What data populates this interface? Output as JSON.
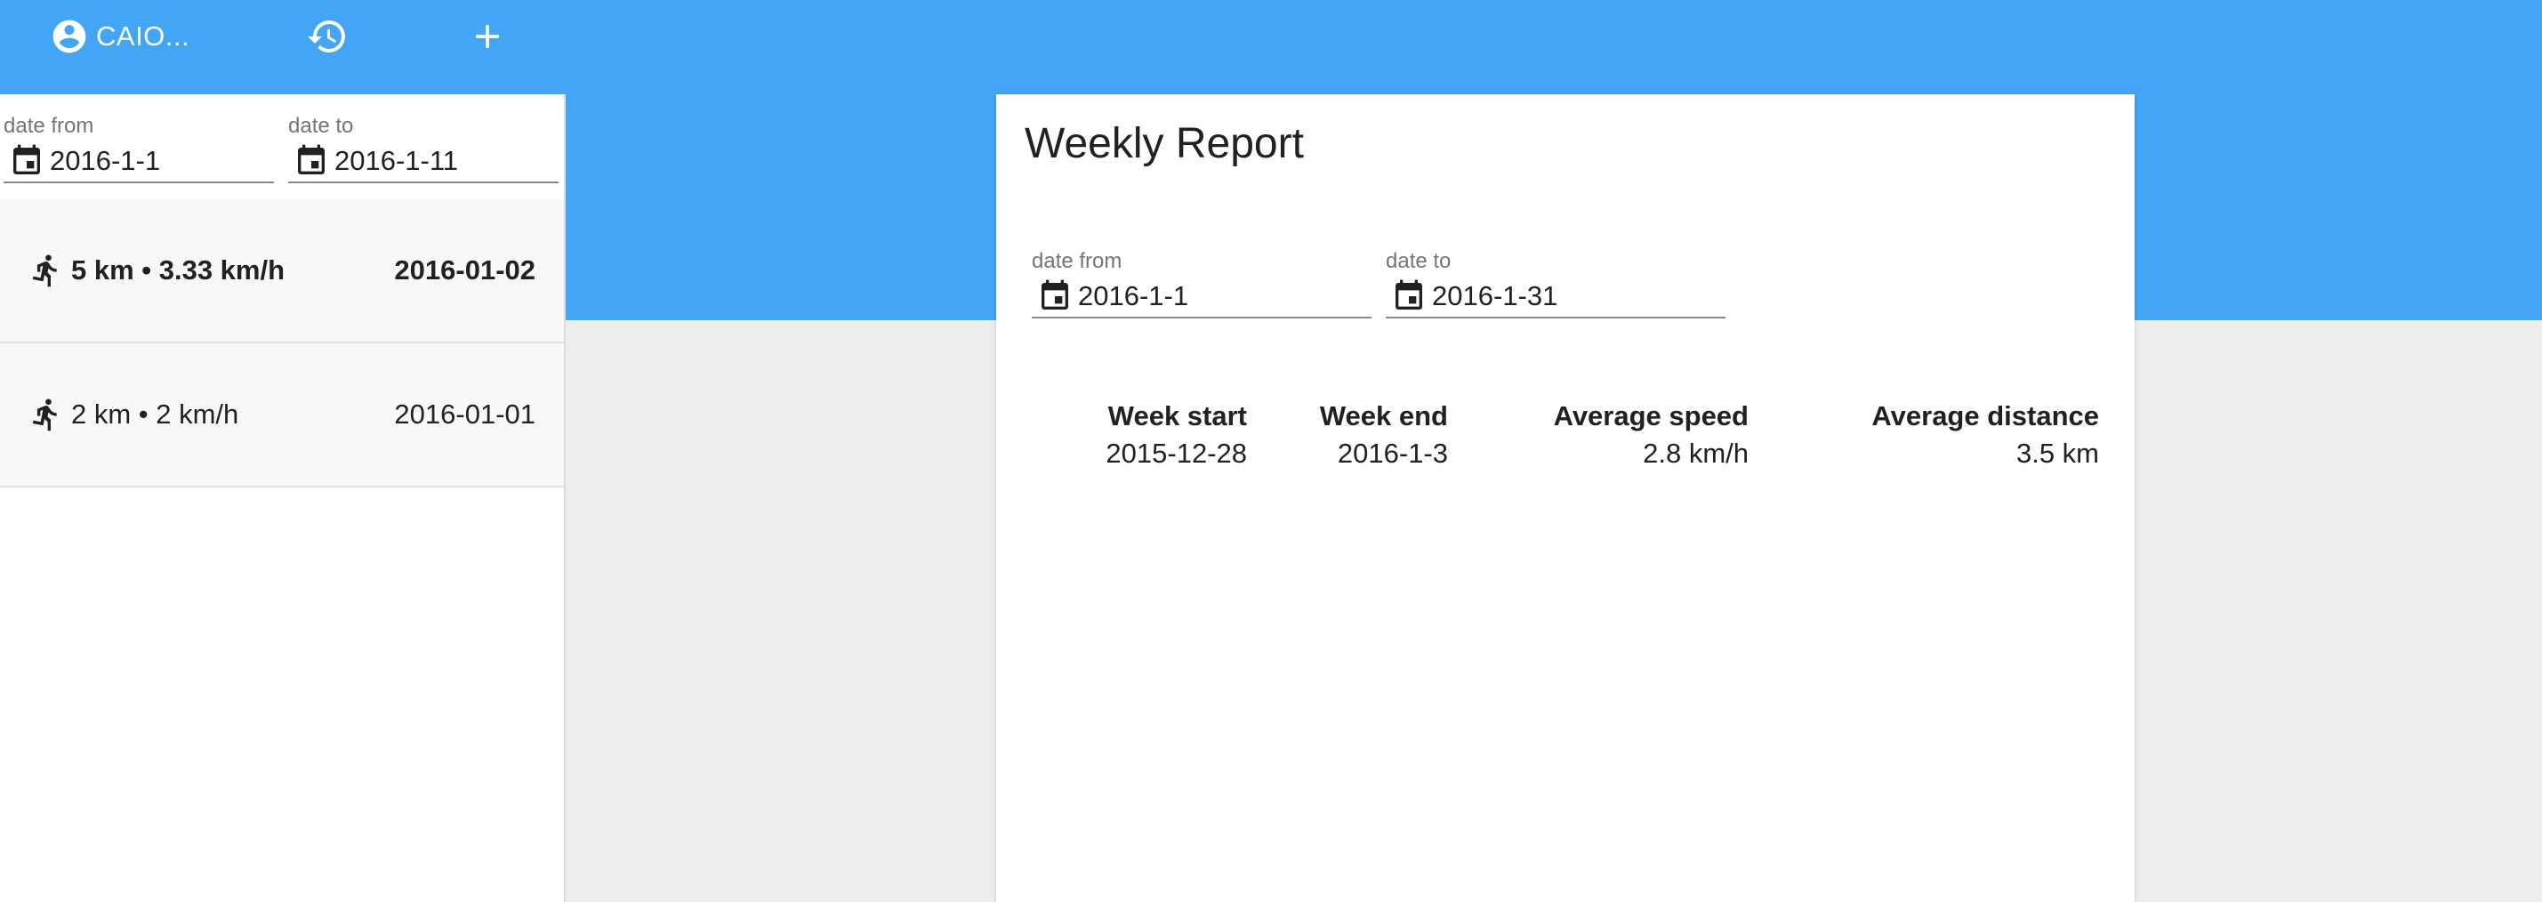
{
  "header": {
    "user_label": "CAIO...",
    "icons": {
      "user": "account-circle-icon",
      "history": "history-icon",
      "add": "add-icon"
    }
  },
  "sidebar": {
    "filter": {
      "from_label": "date from",
      "from_value": "2016-1-1",
      "to_label": "date to",
      "to_value": "2016-1-11"
    },
    "entries": [
      {
        "summary": "5 km • 3.33 km/h",
        "date": "2016-01-02",
        "icon": "run-icon"
      },
      {
        "summary": "2 km • 2 km/h",
        "date": "2016-01-01",
        "icon": "run-icon"
      }
    ]
  },
  "report": {
    "title": "Weekly Report",
    "filter": {
      "from_label": "date from",
      "from_value": "2016-1-1",
      "to_label": "date to",
      "to_value": "2016-1-31"
    },
    "columns": [
      "Week start",
      "Week end",
      "Average speed",
      "Average distance"
    ],
    "rows": [
      [
        "2015-12-28",
        "2016-1-3",
        "2.8 km/h",
        "3.5 km"
      ]
    ]
  },
  "colors": {
    "header_bg": "#42a5f5",
    "page_bg": "#ededed"
  }
}
